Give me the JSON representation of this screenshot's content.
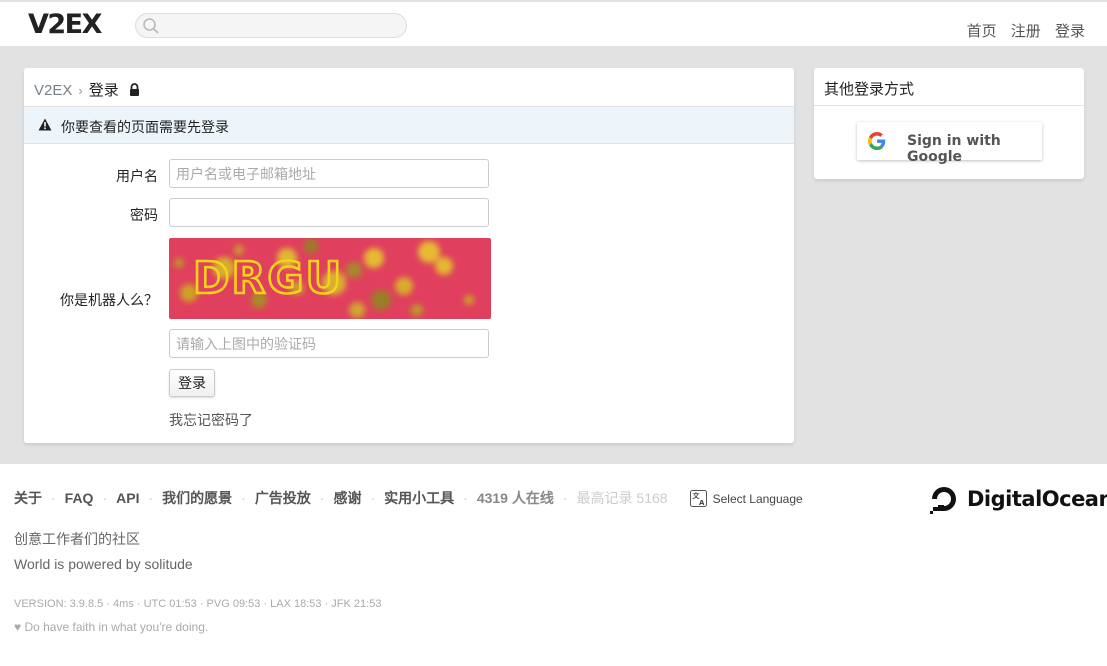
{
  "header": {
    "logo": "V2EX",
    "search_placeholder": "",
    "nav": [
      "首页",
      "注册",
      "登录"
    ]
  },
  "breadcrumb": {
    "home": "V2EX",
    "separator": "›",
    "current": "登录"
  },
  "notice": "你要查看的页面需要先登录",
  "form": {
    "username_label": "用户名",
    "username_placeholder": "用户名或电子邮箱地址",
    "password_label": "密码",
    "captcha_label": "你是机器人么？",
    "captcha_text": "DRGU",
    "captcha_placeholder": "请输入上图中的验证码",
    "submit": "登录",
    "forgot": "我忘记密码了"
  },
  "sidebar": {
    "title": "其他登录方式",
    "google_button": "Sign in with Google"
  },
  "footer": {
    "links": [
      "关于",
      "FAQ",
      "API",
      "我们的愿景",
      "广告投放",
      "感谢",
      "实用小工具"
    ],
    "online": "4319 人在线",
    "record": "最高记录 5168",
    "language": "Select Language",
    "sponsor": "DigitalOcean",
    "slogan1": "创意工作者们的社区",
    "slogan2": "World is powered by solitude",
    "version": "VERSION: 3.9.8.5 · 4ms · UTC 01:53 · PVG 09:53 · LAX 18:53 · JFK 21:53",
    "faith": "♥ Do have faith in what you're doing."
  },
  "colors": {
    "page_bg": "#e2e2e2",
    "notice_bg": "#eef5fa",
    "captcha_bg": "#e0405e",
    "captcha_text": "#f2d21b"
  }
}
